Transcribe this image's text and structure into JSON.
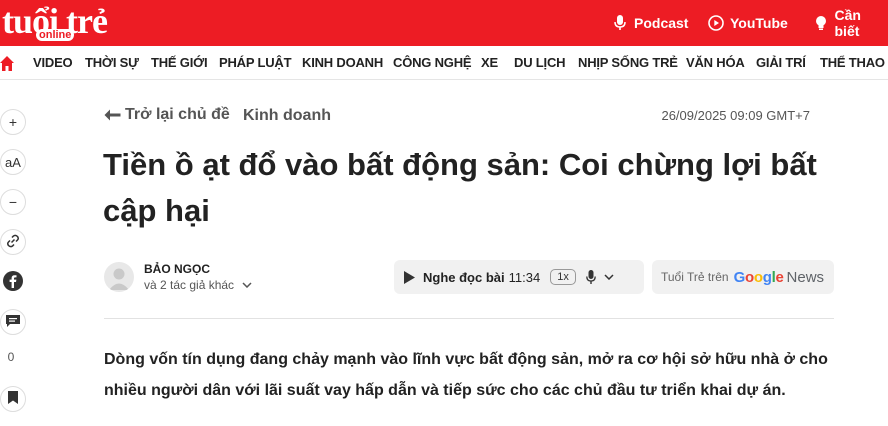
{
  "header": {
    "logo_main": "tuổi trẻ",
    "logo_sub": "online",
    "links": [
      {
        "label": "Podcast",
        "icon": "microphone-icon"
      },
      {
        "label": "YouTube",
        "icon": "youtube-icon"
      },
      {
        "label": "Cần biết",
        "icon": "lightbulb-icon"
      }
    ]
  },
  "nav": {
    "items": [
      "VIDEO",
      "THỜI SỰ",
      "THẾ GIỚI",
      "PHÁP LUẬT",
      "KINH DOANH",
      "CÔNG NGHỆ",
      "XE",
      "DU LỊCH",
      "NHỊP SỐNG TRẺ",
      "VĂN HÓA",
      "GIẢI TRÍ",
      "THỂ THAO"
    ]
  },
  "sidebar": {
    "zoom_in": "+",
    "font_size": "aA",
    "zoom_out": "−",
    "comment_count": "0"
  },
  "article": {
    "back_label": "Trở lại chủ đề",
    "category": "Kinh doanh",
    "datetime": "26/09/2025 09:09 GMT+7",
    "title": "Tiền ồ ạt đổ vào bất động sản: Coi chừng lợi bất cập hại",
    "author": "BẢO NGỌC",
    "coauthors": "và 2 tác giả khác",
    "lead": "Dòng vốn tín dụng đang chảy mạnh vào lĩnh vực bất động sản, mở ra cơ hội sở hữu nhà ở cho nhiều người dân với lãi suất vay hấp dẫn và tiếp sức cho các chủ đầu tư triển khai dự án."
  },
  "player": {
    "label": "Nghe đọc bài",
    "duration": "11:34",
    "speed": "1x"
  },
  "gnews": {
    "prefix": "Tuổi Trẻ trên",
    "google": "Google",
    "news": "News"
  },
  "colors": {
    "brand": "#ed1c24",
    "google_blue": "#4285f4",
    "google_red": "#ea4335",
    "google_yellow": "#fbbc05",
    "google_green": "#34a853"
  }
}
